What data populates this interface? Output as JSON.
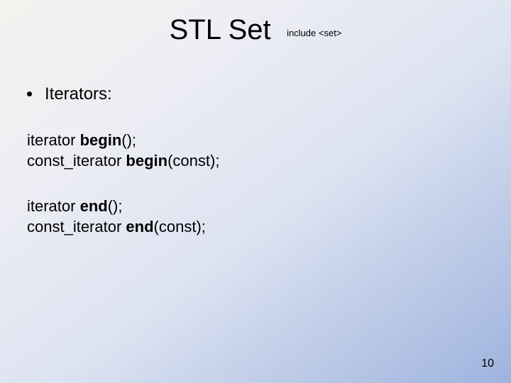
{
  "title": "STL Set",
  "subtitle": "include <set>",
  "bullet": "Iterators:",
  "block1": {
    "line1_pre": "iterator ",
    "line1_bold": "begin",
    "line1_post": "();",
    "line2_pre": "const_iterator ",
    "line2_bold": "begin",
    "line2_post": "(const);"
  },
  "block2": {
    "line1_pre": "iterator ",
    "line1_bold": "end",
    "line1_post": "();",
    "line2_pre": "const_iterator ",
    "line2_bold": "end",
    "line2_post": "(const);"
  },
  "page_number": "10"
}
